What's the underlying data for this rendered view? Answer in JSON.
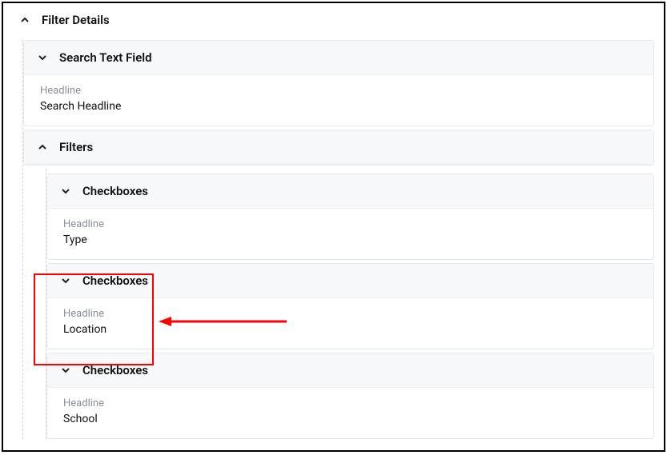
{
  "colors": {
    "highlight": "#ff0000",
    "headerBg": "#f7f8fa",
    "border": "#e5e7eb",
    "muted": "#8a8f98"
  },
  "root": {
    "title": "Filter Details",
    "children": [
      {
        "title": "Search Text Field",
        "field_label": "Headline",
        "field_value": "Search Headline"
      },
      {
        "title": "Filters",
        "children": [
          {
            "title": "Checkboxes",
            "field_label": "Headline",
            "field_value": "Type"
          },
          {
            "title": "Checkboxes",
            "field_label": "Headline",
            "field_value": "Location"
          },
          {
            "title": "Checkboxes",
            "field_label": "Headline",
            "field_value": "School"
          }
        ]
      }
    ]
  }
}
